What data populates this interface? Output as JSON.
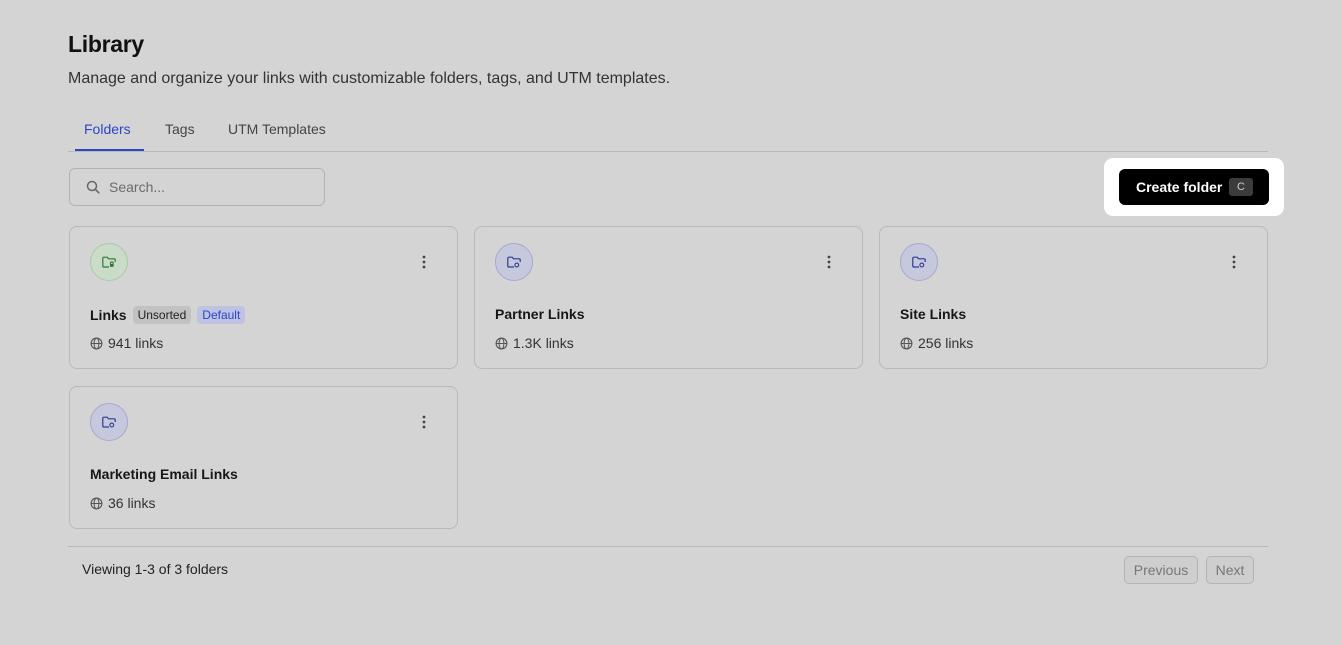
{
  "header": {
    "title": "Library",
    "subtitle": "Manage and organize your links with customizable folders, tags, and UTM templates."
  },
  "tabs": [
    {
      "label": "Folders",
      "active": true
    },
    {
      "label": "Tags",
      "active": false
    },
    {
      "label": "UTM Templates",
      "active": false
    }
  ],
  "search": {
    "placeholder": "Search...",
    "value": "",
    "icon": "search-icon"
  },
  "create_button": {
    "label": "Create folder",
    "shortcut": "C"
  },
  "folders": [
    {
      "name": "Links",
      "badges": [
        "Unsorted",
        "Default"
      ],
      "count": "941 links",
      "icon_color": "#2f7a33"
    },
    {
      "name": "Partner Links",
      "badges": [],
      "count": "1.3K links",
      "icon_color": "#2f3a8f"
    },
    {
      "name": "Site Links",
      "badges": [],
      "count": "256 links",
      "icon_color": "#2f3a8f"
    },
    {
      "name": "Marketing Email Links",
      "badges": [],
      "count": "36 links",
      "icon_color": "#2f3a8f"
    }
  ],
  "footer": {
    "viewing": "Viewing 1-3 of 3 folders",
    "previous": "Previous",
    "next": "Next"
  },
  "colors": {
    "accent": "#2b46c9",
    "background": "#d4d4d4",
    "button": "#000000"
  }
}
